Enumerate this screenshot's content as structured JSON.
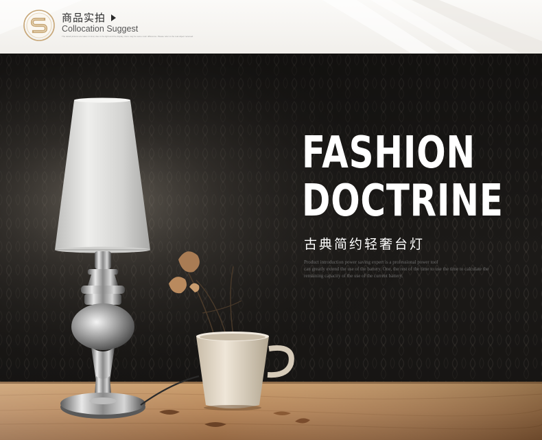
{
  "header": {
    "title": "商品实拍",
    "subtitle": "Collocation Suggest",
    "fine_print": "The detail pictures are taken in kind, due to the light and the display, there may be some color difference. Please refer to the real object received."
  },
  "icons": {
    "logo": "s-logo-icon",
    "arrow": "play-arrow-icon"
  },
  "banner": {
    "headline_line1": "FASHION",
    "headline_line2": "DOCTRINE",
    "subtitle_cn": "古典简约轻奢台灯",
    "intro_line1": "Product introduction power saving expert is a professional power tool",
    "intro_line2": "can greatly extend the use of the battery. One, the rest of the time to use the time to calculate the",
    "intro_line3": "remaining capacity of the use of the current battery."
  },
  "colors": {
    "wall": "#1a1816",
    "table": "#b98a58",
    "logo_gold": "#c7a676",
    "lamp_shade": "#d8d8d6",
    "chrome": "#9d9d9d",
    "cup": "#e6dccd"
  }
}
